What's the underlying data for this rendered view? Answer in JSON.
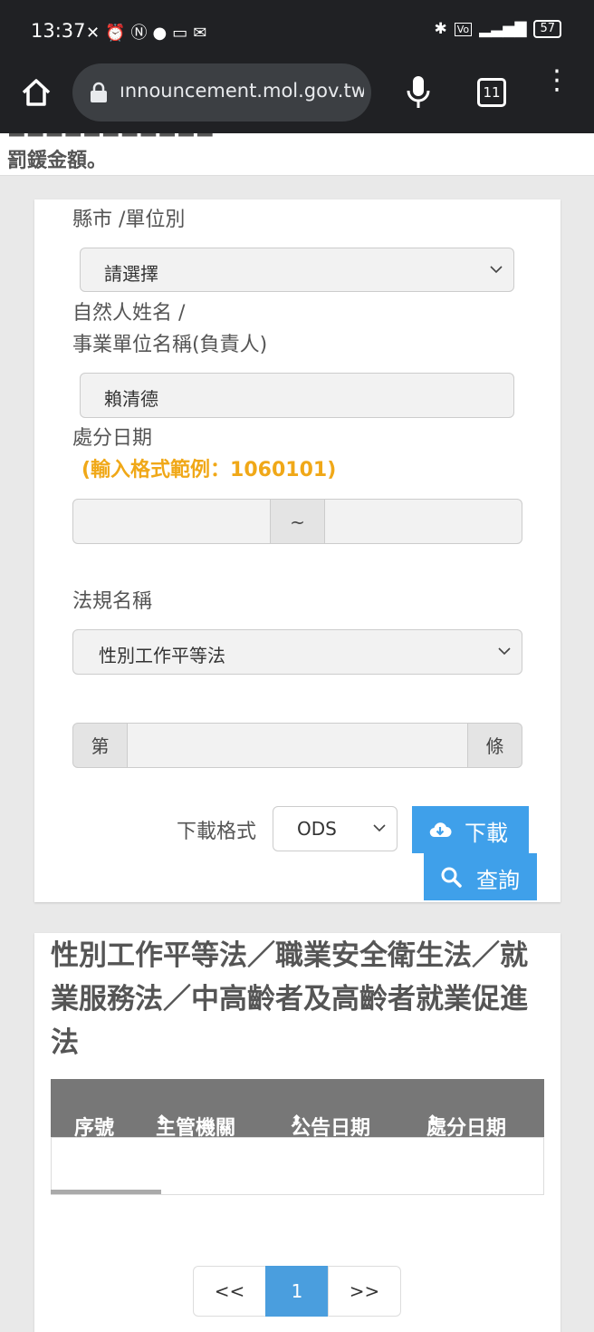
{
  "status_bar": {
    "time": "13:37",
    "battery": "57",
    "tabs_count": "11"
  },
  "browser": {
    "url": "ınnouncement.mol.gov.tw"
  },
  "page": {
    "top_partial_text": "罰鍰金額。",
    "form": {
      "county_label": "縣市 /單位別",
      "county_value": "請選擇",
      "name_label_line1": "自然人姓名 /",
      "name_label_line2": "事業單位名稱(負責人)",
      "name_value": "賴清德",
      "date_label": "處分日期",
      "date_hint": "(輸入格式範例：1060101)",
      "date_start": "",
      "date_separator": "~",
      "date_end": "",
      "law_label": "法規名稱",
      "law_value": "性別工作平等法",
      "article_prefix": "第",
      "article_value": "",
      "article_suffix": "條",
      "download_format_label": "下載格式",
      "download_format_value": "ODS",
      "download_button": "下載",
      "search_button": "查詢"
    },
    "results": {
      "heading": "性別工作平等法／職業安全衛生法／就業服務法／中高齡者及高齡者就業促進法",
      "columns": [
        "序號",
        "主管機關",
        "公告日期",
        "處分日期"
      ],
      "sort_icon": "⬍"
    },
    "pagination": {
      "prev": "<<",
      "current": "1",
      "next": ">>"
    }
  },
  "colors": {
    "accent_blue": "#3fa0ea",
    "hint_orange": "#f0a818",
    "table_header": "#777777",
    "browser_bar": "#202124"
  }
}
